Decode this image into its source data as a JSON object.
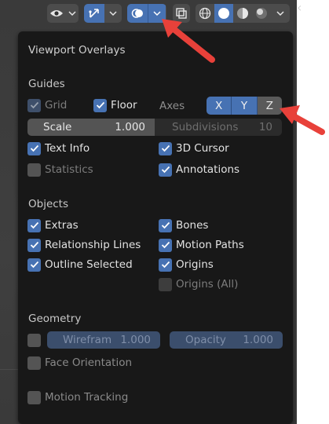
{
  "toolbar": {
    "icons": [
      "eye-icon",
      "chevron-down-icon",
      "gizmo-icon",
      "chevron-down-icon",
      "overlays-icon",
      "chevron-down-icon",
      "xray-icon",
      "wireframe-shading-icon",
      "solid-shading-icon",
      "material-shading-icon",
      "rendered-shading-icon",
      "chevron-down-icon"
    ]
  },
  "popover": {
    "title": "Viewport Overlays",
    "guides": {
      "heading": "Guides",
      "grid": "Grid",
      "floor": "Floor",
      "axes_label": "Axes",
      "axes": [
        "X",
        "Y",
        "Z"
      ],
      "scale_label": "Scale",
      "scale_value": "1.000",
      "subdivisions_label": "Subdivisions",
      "subdivisions_value": "10",
      "text_info": "Text Info",
      "cursor_3d": "3D Cursor",
      "statistics": "Statistics",
      "annotations": "Annotations"
    },
    "objects": {
      "heading": "Objects",
      "extras": "Extras",
      "bones": "Bones",
      "relationship_lines": "Relationship Lines",
      "motion_paths": "Motion Paths",
      "outline_selected": "Outline Selected",
      "origins": "Origins",
      "origins_all": "Origins (All)"
    },
    "geometry": {
      "heading": "Geometry",
      "wireframe_label": "Wirefram",
      "wireframe_value": "1.000",
      "opacity_label": "Opacity",
      "opacity_value": "1.000",
      "face_orientation": "Face Orientation"
    },
    "motion_tracking": "Motion Tracking"
  },
  "colors": {
    "accent": "#4772b3",
    "popover_bg": "#181818",
    "arrow": "#e8413a"
  }
}
